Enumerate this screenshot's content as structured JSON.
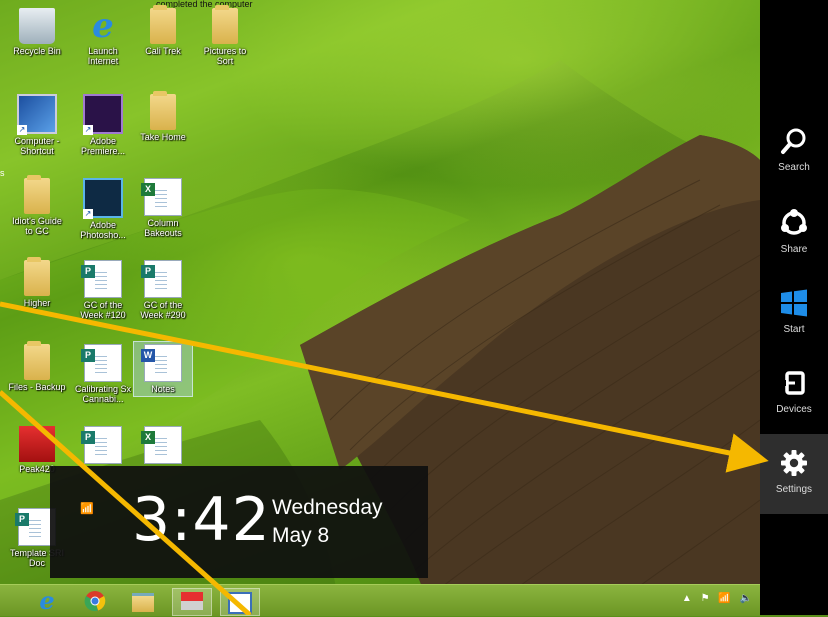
{
  "desktop": {
    "edge_text_top": "completed the computer",
    "edge_text_mid": "s",
    "icons": [
      {
        "id": "recycle",
        "label": "Recycle Bin"
      },
      {
        "id": "ie",
        "label": "Launch Internet"
      },
      {
        "id": "calitrek",
        "label": "Cali Trek"
      },
      {
        "id": "pictures",
        "label": "Pictures to Sort"
      },
      {
        "id": "computer",
        "label": "Computer - Shortcut"
      },
      {
        "id": "premiere",
        "label": "Adobe Premiere..."
      },
      {
        "id": "takehome",
        "label": "Take Home"
      },
      {
        "id": "idiots",
        "label": "Idiot's Guide to GC"
      },
      {
        "id": "photoshop",
        "label": "Adobe Photosho..."
      },
      {
        "id": "column",
        "label": "Column Bakeouts"
      },
      {
        "id": "higher",
        "label": "Higher"
      },
      {
        "id": "gc1",
        "label": "GC of the Week #120"
      },
      {
        "id": "gc2",
        "label": "GC of the Week #290"
      },
      {
        "id": "backup",
        "label": "Files - Backup"
      },
      {
        "id": "calib",
        "label": "Calibrating Sx Cannabi..."
      },
      {
        "id": "notes",
        "label": "Notes"
      },
      {
        "id": "peak",
        "label": "Peak420"
      },
      {
        "id": "pub3",
        "label": ""
      },
      {
        "id": "xls3",
        "label": ""
      },
      {
        "id": "templ",
        "label": "Template SRI Doc"
      }
    ]
  },
  "charms": [
    {
      "id": "search",
      "label": "Search",
      "icon": "search-icon"
    },
    {
      "id": "share",
      "label": "Share",
      "icon": "share-icon"
    },
    {
      "id": "start",
      "label": "Start",
      "icon": "windows-logo-icon"
    },
    {
      "id": "devices",
      "label": "Devices",
      "icon": "devices-icon"
    },
    {
      "id": "settings",
      "label": "Settings",
      "icon": "gear-icon"
    }
  ],
  "clock": {
    "time": "3:42",
    "day": "Wednesday",
    "date": "May 8",
    "signal": "📶"
  },
  "taskbar": {
    "items": [
      "internet-explorer-icon",
      "chrome-icon",
      "file-explorer-icon",
      "app-red-icon",
      "app-blue-icon"
    ],
    "tray": {
      "arrow": "▲",
      "flag": "⚑",
      "network": "📶",
      "volume": "🔈"
    }
  },
  "colors": {
    "arrow": "#f5b800",
    "charms_bg": "#000000",
    "start_blue": "#1e8de8",
    "taskbar": "#7aa530"
  }
}
